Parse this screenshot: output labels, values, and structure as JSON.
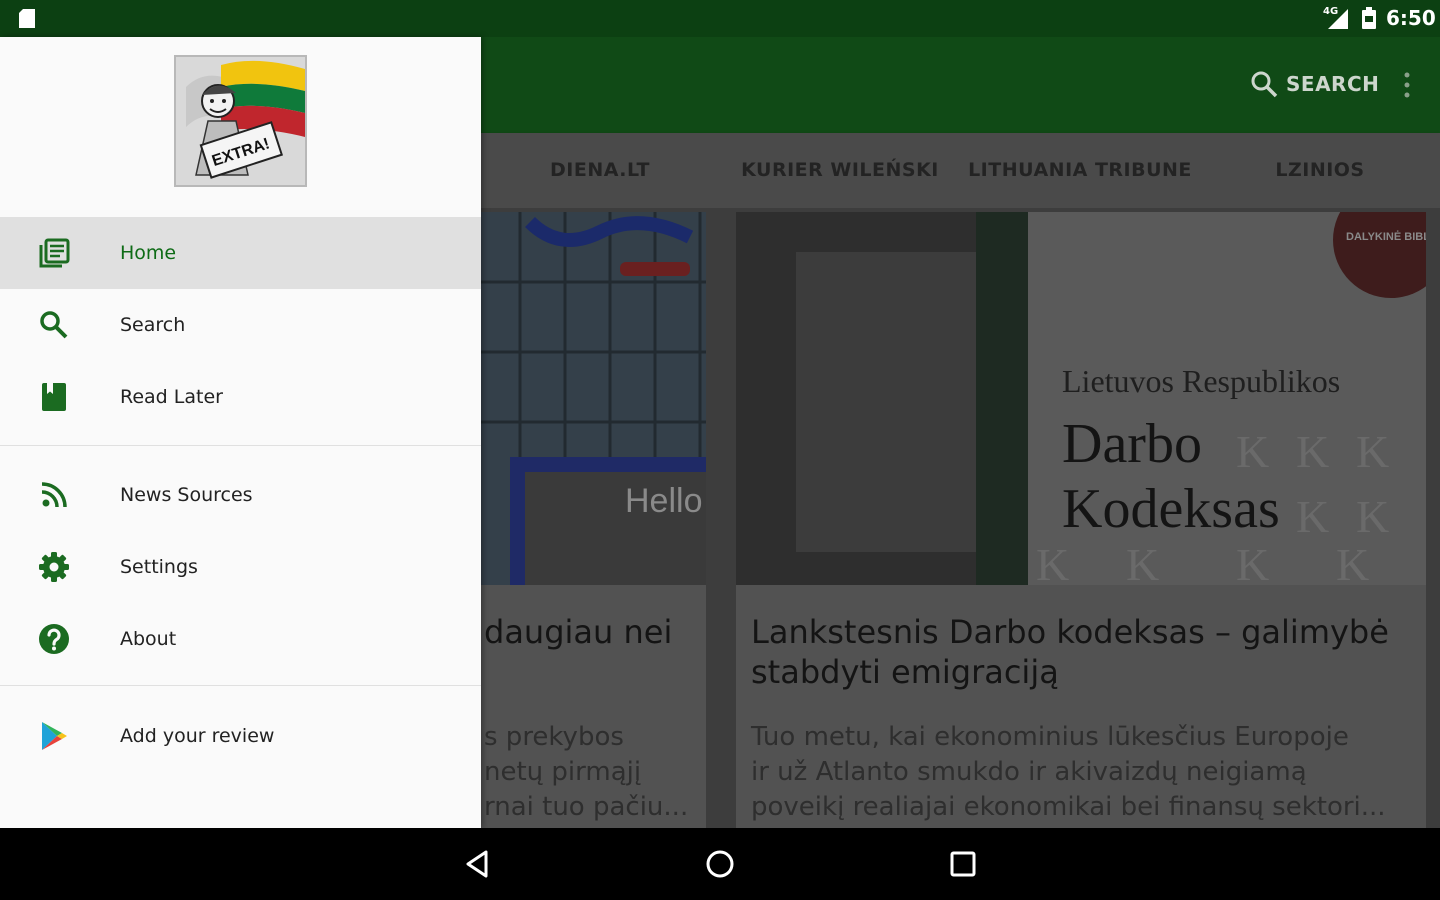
{
  "status_bar": {
    "time": "6:50",
    "network": "4G",
    "icons": [
      "sd-card-icon",
      "signal-icon",
      "battery-icon"
    ]
  },
  "app_bar": {
    "search_label": "SEARCH",
    "icons": [
      "search-icon",
      "overflow-menu-icon"
    ]
  },
  "tabs": [
    {
      "label": "DIENA.LT"
    },
    {
      "label": "KURIER WILEŃSKI"
    },
    {
      "label": "LITHUANIA TRIBUNE"
    },
    {
      "label": "LZINIOS"
    }
  ],
  "cards": [
    {
      "title": "daugiau nei",
      "desc": [
        "s prekybos",
        "netų pirmąjį",
        "rnai tuo pačiu..."
      ],
      "image_text": "Hello"
    },
    {
      "title": "Lankstesnis Darbo kodeksas – galimybė stabdyti emigraciją",
      "desc": [
        "Tuo metu, kai ekonominius lūkesčius Europoje",
        "ir už Atlanto smukdo ir akivaizdų neigiamą",
        "poveikį realiajai ekonomikai bei finansų sektori..."
      ],
      "image_text": {
        "line1": "Lietuvos Respublikos",
        "line2": "Darbo",
        "line3": "Kodeksas",
        "badge": "DALYKINĖ BIBLIOTEKA"
      }
    }
  ],
  "drawer": {
    "logo_text": "EXTRA!",
    "menu": [
      {
        "label": "Home",
        "icon": "newspaper-icon",
        "active": true
      },
      {
        "label": "Search",
        "icon": "search-icon",
        "active": false
      },
      {
        "label": "Read Later",
        "icon": "bookmark-book-icon",
        "active": false
      },
      {
        "label": "News Sources",
        "icon": "rss-icon",
        "active": false
      },
      {
        "label": "Settings",
        "icon": "gear-icon",
        "active": false
      },
      {
        "label": "About",
        "icon": "help-circle-icon",
        "active": false
      },
      {
        "label": "Add your review",
        "icon": "play-store-icon",
        "active": false
      }
    ]
  },
  "colors": {
    "primary": "#0c4012",
    "primary_light": "#104a16",
    "accent_green": "#1b6b21",
    "drawer_bg": "#fafafa",
    "active_item_bg": "#e0e0e0",
    "scrim_dark": "#3d3d3d"
  },
  "nav_bar": {
    "icons": [
      "back-icon",
      "home-icon",
      "recents-icon"
    ]
  }
}
